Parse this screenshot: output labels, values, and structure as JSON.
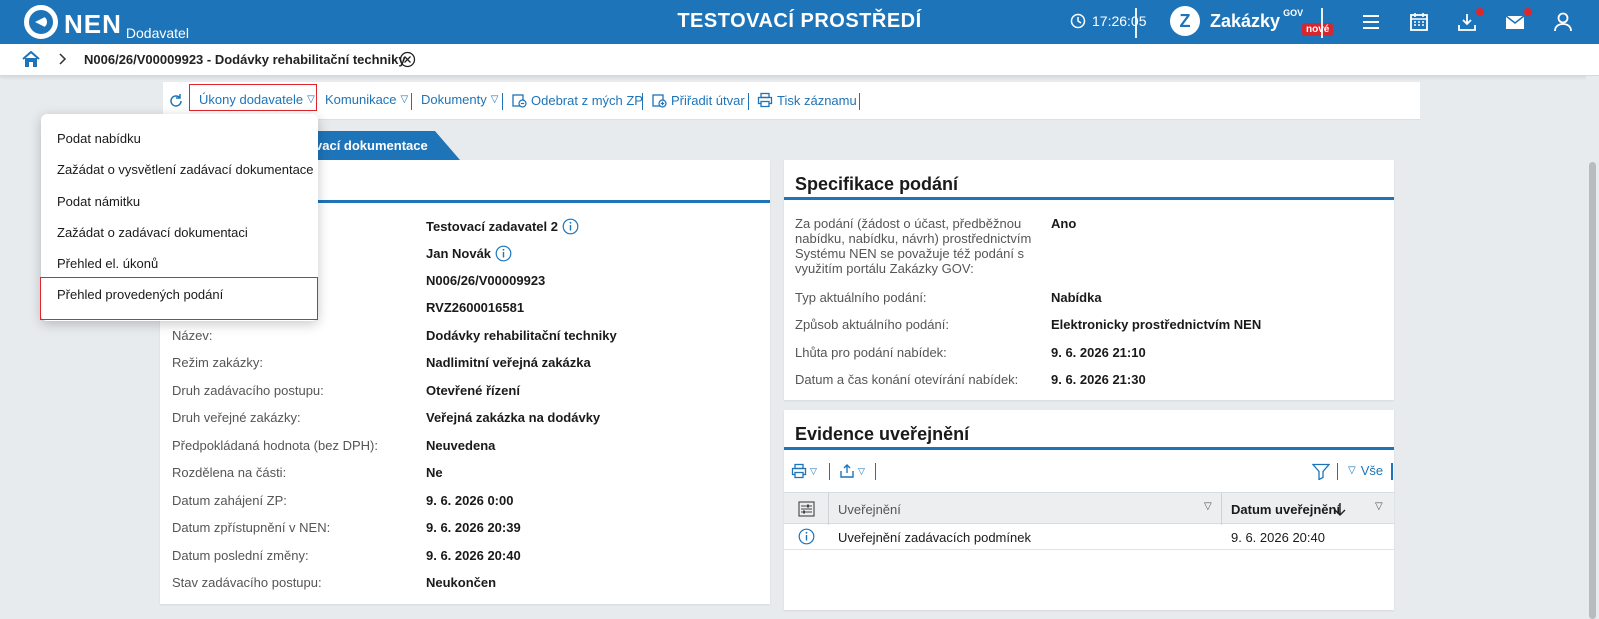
{
  "topbar": {
    "logo_text": "NEN",
    "logo_sub": "Dodavatel",
    "environment": "TESTOVACÍ PROSTŘEDÍ",
    "time": "17:26:05",
    "zakazky_label": "Zakázky",
    "zakazky_gov": "GOV",
    "zakazky_new": "nové",
    "icons": [
      "menu-icon",
      "calendar-icon",
      "download-icon",
      "mail-icon",
      "user-icon"
    ]
  },
  "breadcrumb": {
    "title": "N006/26/V00009923 - Dodávky rehabilitační techniky"
  },
  "toolbar": {
    "ukony": "Úkony dodavatele",
    "komunikace": "Komunikace",
    "dokumenty": "Dokumenty",
    "odebrat": "Odebrat z mých ZP",
    "priradit": "Přiřadit útvar",
    "tisk": "Tisk záznamu"
  },
  "tab": {
    "label": "vací dokumentace"
  },
  "menu": {
    "items": [
      "Podat nabídku",
      "Zažádat o vysvětlení zadávací dokumentace",
      "Podat námitku",
      "Zažádat o zadávací dokumentaci",
      "Přehled el. úkonů",
      "Přehled provedených podání"
    ]
  },
  "detail": {
    "rows": [
      {
        "label": "",
        "value": "Testovací zadavatel 2"
      },
      {
        "label": "",
        "value": "Jan Novák"
      },
      {
        "label": "",
        "value": "N006/26/V00009923"
      },
      {
        "label": "",
        "value": "RVZ2600016581"
      },
      {
        "label": "Název:",
        "value": "Dodávky rehabilitační techniky"
      },
      {
        "label": "Režim zakázky:",
        "value": "Nadlimitní veřejná zakázka"
      },
      {
        "label": "Druh zadávacího postupu:",
        "value": "Otevřené řízení"
      },
      {
        "label": "Druh veřejné zakázky:",
        "value": "Veřejná zakázka na dodávky"
      },
      {
        "label": "Předpokládaná hodnota (bez DPH):",
        "value": "Neuvedena"
      },
      {
        "label": "Rozdělena na části:",
        "value": "Ne"
      },
      {
        "label": "Datum zahájení ZP:",
        "value": "9. 6. 2026 0:00"
      },
      {
        "label": "Datum zpřístupnění v NEN:",
        "value": "9. 6. 2026 20:39"
      },
      {
        "label": "Datum poslední změny:",
        "value": "9. 6. 2026 20:40"
      },
      {
        "label": "Stav zadávacího postupu:",
        "value": "Neukončen"
      }
    ]
  },
  "spec": {
    "title": "Specifikace podání",
    "rows": [
      {
        "label": "Za podání (žádost o účast, předběžnou nabídku, nabídku, návrh) prostřednictvím Systému NEN se považuje též podání s využitím portálu Zakázky GOV:",
        "value": "Ano"
      },
      {
        "label": "Typ aktuálního podání:",
        "value": "Nabídka"
      },
      {
        "label": "Způsob aktuálního podání:",
        "value": "Elektronicky prostřednictvím NEN"
      },
      {
        "label": "Lhůta pro podání nabídek:",
        "value": "9. 6. 2026 21:10"
      },
      {
        "label": "Datum a čas konání otevírání nabídek:",
        "value": "9. 6. 2026 21:30"
      }
    ]
  },
  "evidence": {
    "title": "Evidence uveřejnění",
    "filter_all": "Vše",
    "col_publication": "Uveřejnění",
    "col_date": "Datum uveřejnění",
    "rows": [
      {
        "publication": "Uveřejnění zadávacích podmínek",
        "date": "9. 6. 2026 20:40"
      }
    ]
  },
  "colors": {
    "brand": "#1e74b8",
    "highlight": "#e0262c",
    "badge": "#d7262e"
  }
}
